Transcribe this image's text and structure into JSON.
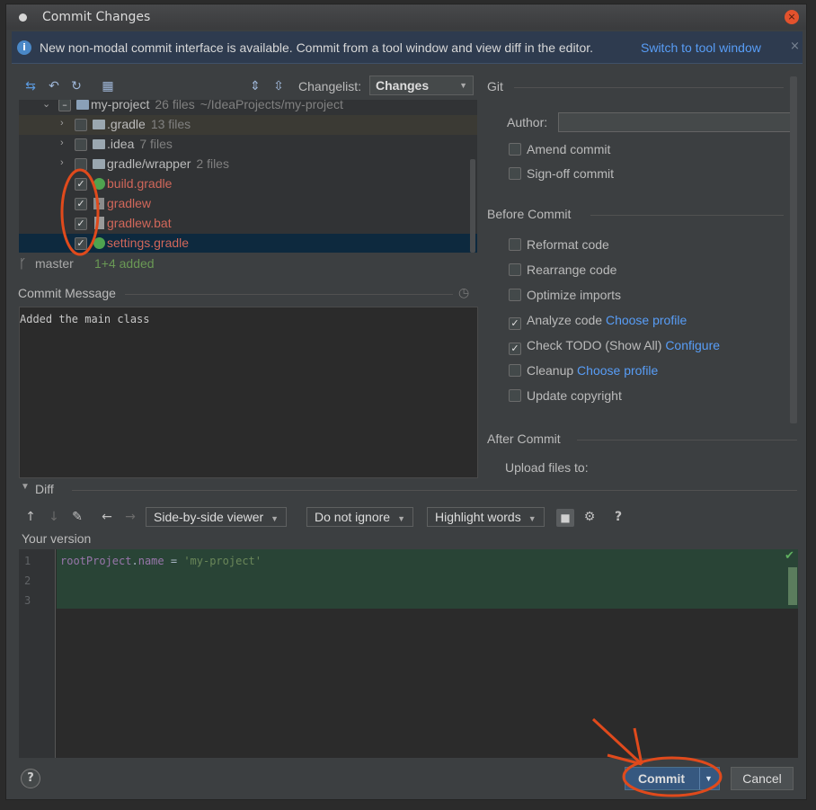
{
  "window": {
    "title": "Commit Changes",
    "close_glyph": "×"
  },
  "banner": {
    "text": "New non-modal commit interface is available. Commit from a tool window and view diff in the editor.",
    "link": "Switch to tool window",
    "close_glyph": "×"
  },
  "toolbar": {
    "changelist_label": "Changelist:",
    "changelist_value": "Changes"
  },
  "tree": {
    "root": {
      "name": "my-project",
      "count": "26 files",
      "path": "~/IdeaProjects/my-project"
    },
    "folders": [
      {
        "name": ".gradle",
        "count": "13 files"
      },
      {
        "name": ".idea",
        "count": "7 files"
      },
      {
        "name": "gradle/wrapper",
        "count": "2 files"
      }
    ],
    "files": [
      {
        "name": "build.gradle",
        "icon": "gradle-icon"
      },
      {
        "name": "gradlew",
        "icon": "terminal-icon"
      },
      {
        "name": "gradlew.bat",
        "icon": "file-icon"
      },
      {
        "name": "settings.gradle",
        "icon": "gradle-icon"
      }
    ]
  },
  "status": {
    "branch": "master",
    "summary": "1+4 added"
  },
  "commit_message": {
    "label": "Commit Message",
    "text": "Added the main class"
  },
  "git": {
    "section": "Git",
    "author_label": "Author:",
    "author_value": "",
    "options": [
      {
        "label": "Amend commit",
        "checked": false
      },
      {
        "label": "Sign-off commit",
        "checked": false
      }
    ]
  },
  "before_commit": {
    "section": "Before Commit",
    "options": [
      {
        "label": "Reformat code",
        "checked": false,
        "link": ""
      },
      {
        "label": "Rearrange code",
        "checked": false,
        "link": ""
      },
      {
        "label": "Optimize imports",
        "checked": false,
        "link": ""
      },
      {
        "label": "Analyze code",
        "checked": true,
        "link": "Choose profile"
      },
      {
        "label": "Check TODO (Show All)",
        "checked": true,
        "link": "Configure"
      },
      {
        "label": "Cleanup",
        "checked": false,
        "link": "Choose profile"
      },
      {
        "label": "Update copyright",
        "checked": false,
        "link": ""
      }
    ]
  },
  "after_commit": {
    "section": "After Commit",
    "upload_label": "Upload files to:"
  },
  "diff": {
    "section": "Diff",
    "viewer": "Side-by-side viewer",
    "ignore": "Do not ignore",
    "highlight": "Highlight words",
    "help_glyph": "?",
    "your_version": "Your version",
    "line_numbers": [
      "1",
      "2",
      "3"
    ],
    "code": {
      "ident": "rootProject",
      "dot": ".",
      "prop": "name",
      "op": " = ",
      "str": "'my-project'"
    }
  },
  "buttons": {
    "commit": "Commit",
    "cancel": "Cancel",
    "help": "?"
  },
  "colors": {
    "accent_link": "#589df6",
    "added_file": "#d1675a",
    "annotation": "#e04a1c",
    "added_bg": "#294436"
  }
}
